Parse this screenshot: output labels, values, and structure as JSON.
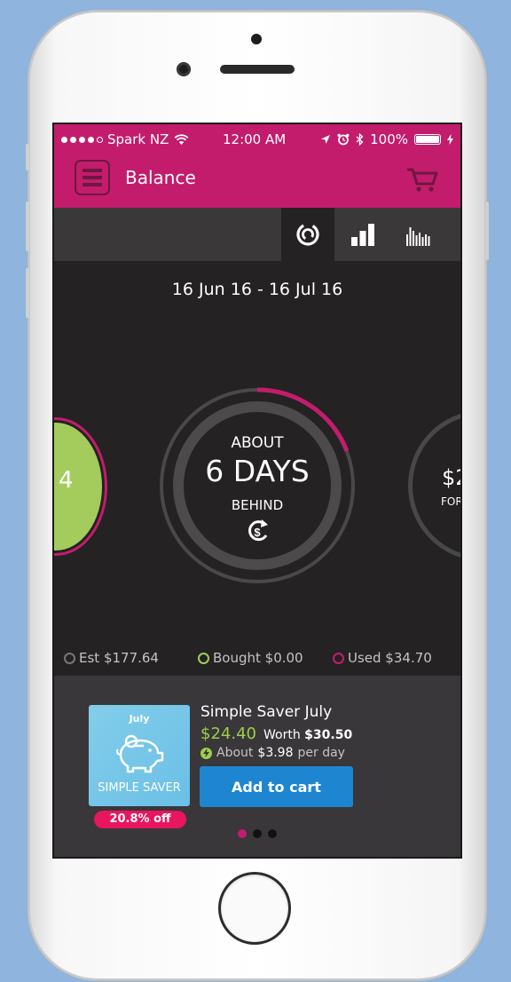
{
  "status_bar": {
    "carrier": "Spark NZ",
    "time": "12:00 AM",
    "battery": "100%"
  },
  "nav": {
    "title": "Balance"
  },
  "tabs": [
    {
      "name": "gauge-view-icon",
      "active": true
    },
    {
      "name": "bar-chart-view-icon",
      "active": false
    },
    {
      "name": "histogram-view-icon",
      "active": false
    }
  ],
  "period": {
    "date_range": "16 Jun 16 - 16 Jul 16"
  },
  "carousel": {
    "left_value": "4",
    "center": {
      "label_top": "ABOUT",
      "value": "6 DAYS",
      "label_bottom": "BEHIND"
    },
    "right_value": "$2",
    "right_label": "FOR"
  },
  "legend": {
    "estimated": "Est $177.64",
    "bought": "Bought $0.00",
    "used": "Used $34.70"
  },
  "offer": {
    "tile_month": "July",
    "tile_name": "SIMPLE SAVER",
    "discount": "20.8% off",
    "title": "Simple Saver July",
    "price": "$24.40",
    "worth_label": "Worth",
    "worth_value": "$30.50",
    "per_day_prefix": "About",
    "per_day_value": "$3.98",
    "per_day_suffix": "per day",
    "add_button": "Add to cart"
  },
  "pager": {
    "count": 3,
    "active_index": 0
  },
  "colors": {
    "brand": "#c31c6c",
    "background": "#242223",
    "green": "#9ccf4a",
    "button_blue": "#1e86d1"
  }
}
